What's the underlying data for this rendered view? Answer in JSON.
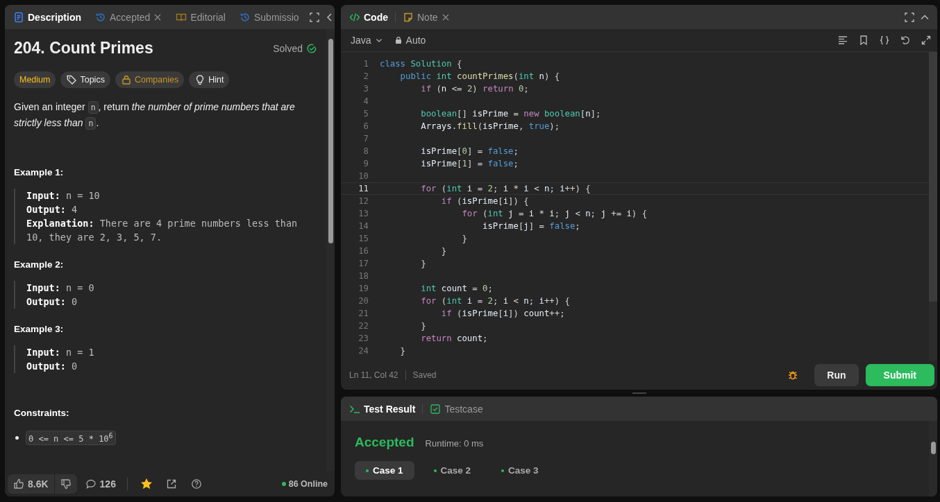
{
  "left_tabs": [
    {
      "label": "Description",
      "kind": "doc",
      "selected": true,
      "closable": false
    },
    {
      "label": "Accepted",
      "kind": "history",
      "selected": false,
      "closable": true
    },
    {
      "label": "Editorial",
      "kind": "book",
      "selected": false,
      "closable": false
    },
    {
      "label": "Submissio",
      "kind": "history",
      "selected": false,
      "closable": false
    }
  ],
  "problem": {
    "title": "204. Count Primes",
    "status": "Solved",
    "tags": [
      {
        "label": "Medium",
        "kind": "difficulty"
      },
      {
        "label": "Topics",
        "kind": "topics"
      },
      {
        "label": "Companies",
        "kind": "companies"
      },
      {
        "label": "Hint",
        "kind": "hint"
      }
    ],
    "description": [
      {
        "t": "Given an integer ",
        "kind": "text"
      },
      {
        "t": "n",
        "kind": "code"
      },
      {
        "t": ", return ",
        "kind": "text"
      },
      {
        "t": "the number of prime numbers that are strictly less than ",
        "kind": "em"
      },
      {
        "t": "n",
        "kind": "code"
      },
      {
        "t": ".",
        "kind": "text"
      }
    ],
    "examples": [
      {
        "title": "Example 1:",
        "lines": [
          "**Input:** n = 10",
          "**Output:** 4",
          "**Explanation:** There are 4 prime numbers less than 10, they are 2, 3, 5, 7."
        ]
      },
      {
        "title": "Example 2:",
        "lines": [
          "**Input:** n = 0",
          "**Output:** 0"
        ]
      },
      {
        "title": "Example 3:",
        "lines": [
          "**Input:** n = 1",
          "**Output:** 0"
        ]
      }
    ],
    "constraints_title": "Constraints:",
    "constraints": [
      "0 <= n <= 5 * 10$^{6}$"
    ]
  },
  "footer": {
    "likes": "8.6K",
    "comments": "126",
    "starred": true,
    "online": "86 Online"
  },
  "editor_tabs": [
    {
      "label": "Code",
      "kind": "code",
      "selected": true,
      "closable": false
    },
    {
      "label": "Note",
      "kind": "note",
      "selected": false,
      "closable": true
    }
  ],
  "language": "Java",
  "mode": "Auto",
  "code": [
    {
      "n": "1",
      "tokens": [
        {
          "t": "class",
          "kind": "kw"
        },
        {
          "t": " Solution",
          "kind": "type"
        },
        {
          "t": " {",
          "kind": "p"
        }
      ]
    },
    {
      "n": "2",
      "tokens": [
        {
          "t": "    public",
          "kind": "kw"
        },
        {
          "t": " int",
          "kind": "type"
        },
        {
          "t": " countPrimes",
          "kind": "fn"
        },
        {
          "t": "(",
          "kind": "p"
        },
        {
          "t": "int",
          "kind": "type"
        },
        {
          "t": " n",
          "kind": "var"
        },
        {
          "t": ") {",
          "kind": "p"
        }
      ]
    },
    {
      "n": "3",
      "tokens": [
        {
          "t": "        if",
          "kind": "ctl"
        },
        {
          "t": " (",
          "kind": "p"
        },
        {
          "t": "n",
          "kind": "var"
        },
        {
          "t": " <= ",
          "kind": "p"
        },
        {
          "t": "2",
          "kind": "num"
        },
        {
          "t": ") ",
          "kind": "p"
        },
        {
          "t": "return",
          "kind": "ctl"
        },
        {
          "t": " 0",
          "kind": "num"
        },
        {
          "t": ";",
          "kind": "p"
        }
      ]
    },
    {
      "n": "4"
    },
    {
      "n": "5",
      "tokens": [
        {
          "t": "        boolean",
          "kind": "type"
        },
        {
          "t": "[] ",
          "kind": "p"
        },
        {
          "t": "isPrime",
          "kind": "var"
        },
        {
          "t": " = ",
          "kind": "p"
        },
        {
          "t": "new",
          "kind": "ctl"
        },
        {
          "t": " boolean",
          "kind": "type"
        },
        {
          "t": "[",
          "kind": "p"
        },
        {
          "t": "n",
          "kind": "var"
        },
        {
          "t": "];",
          "kind": "p"
        }
      ]
    },
    {
      "n": "6",
      "tokens": [
        {
          "t": "        Arrays",
          "kind": "var"
        },
        {
          "t": ".",
          "kind": "p"
        },
        {
          "t": "fill",
          "kind": "fn"
        },
        {
          "t": "(",
          "kind": "p"
        },
        {
          "t": "isPrime",
          "kind": "var"
        },
        {
          "t": ", ",
          "kind": "p"
        },
        {
          "t": "true",
          "kind": "kw"
        },
        {
          "t": ");",
          "kind": "p"
        }
      ]
    },
    {
      "n": "7"
    },
    {
      "n": "8",
      "tokens": [
        {
          "t": "        isPrime",
          "kind": "var"
        },
        {
          "t": "[",
          "kind": "p"
        },
        {
          "t": "0",
          "kind": "num"
        },
        {
          "t": "] = ",
          "kind": "p"
        },
        {
          "t": "false",
          "kind": "kw"
        },
        {
          "t": ";",
          "kind": "p"
        }
      ]
    },
    {
      "n": "9",
      "tokens": [
        {
          "t": "        isPrime",
          "kind": "var"
        },
        {
          "t": "[",
          "kind": "p"
        },
        {
          "t": "1",
          "kind": "num"
        },
        {
          "t": "] = ",
          "kind": "p"
        },
        {
          "t": "false",
          "kind": "kw"
        },
        {
          "t": ";",
          "kind": "p"
        }
      ]
    },
    {
      "n": "10"
    },
    {
      "n": "11",
      "current": true,
      "tokens": [
        {
          "t": "        for",
          "kind": "ctl"
        },
        {
          "t": " (",
          "kind": "p"
        },
        {
          "t": "int",
          "kind": "type"
        },
        {
          "t": " i",
          "kind": "var"
        },
        {
          "t": " = ",
          "kind": "p"
        },
        {
          "t": "2",
          "kind": "num"
        },
        {
          "t": "; ",
          "kind": "p"
        },
        {
          "t": "i",
          "kind": "var"
        },
        {
          "t": " * ",
          "kind": "p"
        },
        {
          "t": "i",
          "kind": "var"
        },
        {
          "t": " < ",
          "kind": "p"
        },
        {
          "t": "n",
          "kind": "var"
        },
        {
          "t": "; ",
          "kind": "p"
        },
        {
          "t": "i",
          "kind": "var"
        },
        {
          "t": "++) {",
          "kind": "p"
        }
      ]
    },
    {
      "n": "12",
      "tokens": [
        {
          "t": "            if",
          "kind": "ctl"
        },
        {
          "t": " (",
          "kind": "p"
        },
        {
          "t": "isPrime",
          "kind": "var"
        },
        {
          "t": "[",
          "kind": "p"
        },
        {
          "t": "i",
          "kind": "var"
        },
        {
          "t": "]) {",
          "kind": "p"
        }
      ]
    },
    {
      "n": "13",
      "tokens": [
        {
          "t": "                for",
          "kind": "ctl"
        },
        {
          "t": " (",
          "kind": "p"
        },
        {
          "t": "int",
          "kind": "type"
        },
        {
          "t": " j",
          "kind": "var"
        },
        {
          "t": " = ",
          "kind": "p"
        },
        {
          "t": "i",
          "kind": "var"
        },
        {
          "t": " * ",
          "kind": "p"
        },
        {
          "t": "i",
          "kind": "var"
        },
        {
          "t": "; ",
          "kind": "p"
        },
        {
          "t": "j",
          "kind": "var"
        },
        {
          "t": " < ",
          "kind": "p"
        },
        {
          "t": "n",
          "kind": "var"
        },
        {
          "t": "; ",
          "kind": "p"
        },
        {
          "t": "j",
          "kind": "var"
        },
        {
          "t": " += ",
          "kind": "p"
        },
        {
          "t": "i",
          "kind": "var"
        },
        {
          "t": ") {",
          "kind": "p"
        }
      ]
    },
    {
      "n": "14",
      "tokens": [
        {
          "t": "                    isPrime",
          "kind": "var"
        },
        {
          "t": "[",
          "kind": "p"
        },
        {
          "t": "j",
          "kind": "var"
        },
        {
          "t": "] = ",
          "kind": "p"
        },
        {
          "t": "false",
          "kind": "kw"
        },
        {
          "t": ";",
          "kind": "p"
        }
      ]
    },
    {
      "n": "15",
      "tokens": [
        {
          "t": "                }",
          "kind": "p"
        }
      ]
    },
    {
      "n": "16",
      "tokens": [
        {
          "t": "            }",
          "kind": "p"
        }
      ]
    },
    {
      "n": "17",
      "tokens": [
        {
          "t": "        }",
          "kind": "p"
        }
      ]
    },
    {
      "n": "18"
    },
    {
      "n": "19",
      "tokens": [
        {
          "t": "        int",
          "kind": "type"
        },
        {
          "t": " count",
          "kind": "var"
        },
        {
          "t": " = ",
          "kind": "p"
        },
        {
          "t": "0",
          "kind": "num"
        },
        {
          "t": ";",
          "kind": "p"
        }
      ]
    },
    {
      "n": "20",
      "tokens": [
        {
          "t": "        for",
          "kind": "ctl"
        },
        {
          "t": " (",
          "kind": "p"
        },
        {
          "t": "int",
          "kind": "type"
        },
        {
          "t": " i",
          "kind": "var"
        },
        {
          "t": " = ",
          "kind": "p"
        },
        {
          "t": "2",
          "kind": "num"
        },
        {
          "t": "; ",
          "kind": "p"
        },
        {
          "t": "i",
          "kind": "var"
        },
        {
          "t": " < ",
          "kind": "p"
        },
        {
          "t": "n",
          "kind": "var"
        },
        {
          "t": "; ",
          "kind": "p"
        },
        {
          "t": "i",
          "kind": "var"
        },
        {
          "t": "++) {",
          "kind": "p"
        }
      ]
    },
    {
      "n": "21",
      "tokens": [
        {
          "t": "            if",
          "kind": "ctl"
        },
        {
          "t": " (",
          "kind": "p"
        },
        {
          "t": "isPrime",
          "kind": "var"
        },
        {
          "t": "[",
          "kind": "p"
        },
        {
          "t": "i",
          "kind": "var"
        },
        {
          "t": "]) ",
          "kind": "p"
        },
        {
          "t": "count",
          "kind": "var"
        },
        {
          "t": "++;",
          "kind": "p"
        }
      ]
    },
    {
      "n": "22",
      "tokens": [
        {
          "t": "        }",
          "kind": "p"
        }
      ]
    },
    {
      "n": "23",
      "tokens": [
        {
          "t": "        return",
          "kind": "ctl"
        },
        {
          "t": " count",
          "kind": "var"
        },
        {
          "t": ";",
          "kind": "p"
        }
      ]
    },
    {
      "n": "24",
      "tokens": [
        {
          "t": "    }",
          "kind": "p"
        }
      ]
    }
  ],
  "status": {
    "position": "Ln 11, Col 42",
    "saved": "Saved"
  },
  "actions": {
    "run": "Run",
    "submit": "Submit"
  },
  "result_tabs": [
    {
      "label": "Test Result",
      "kind": "terminal",
      "selected": true
    },
    {
      "label": "Testcase",
      "kind": "check",
      "selected": false
    }
  ],
  "result": {
    "verdict": "Accepted",
    "runtime": "Runtime: 0 ms",
    "cases": [
      {
        "label": "Case 1",
        "selected": true
      },
      {
        "label": "Case 2",
        "selected": false
      },
      {
        "label": "Case 3",
        "selected": false
      }
    ]
  }
}
